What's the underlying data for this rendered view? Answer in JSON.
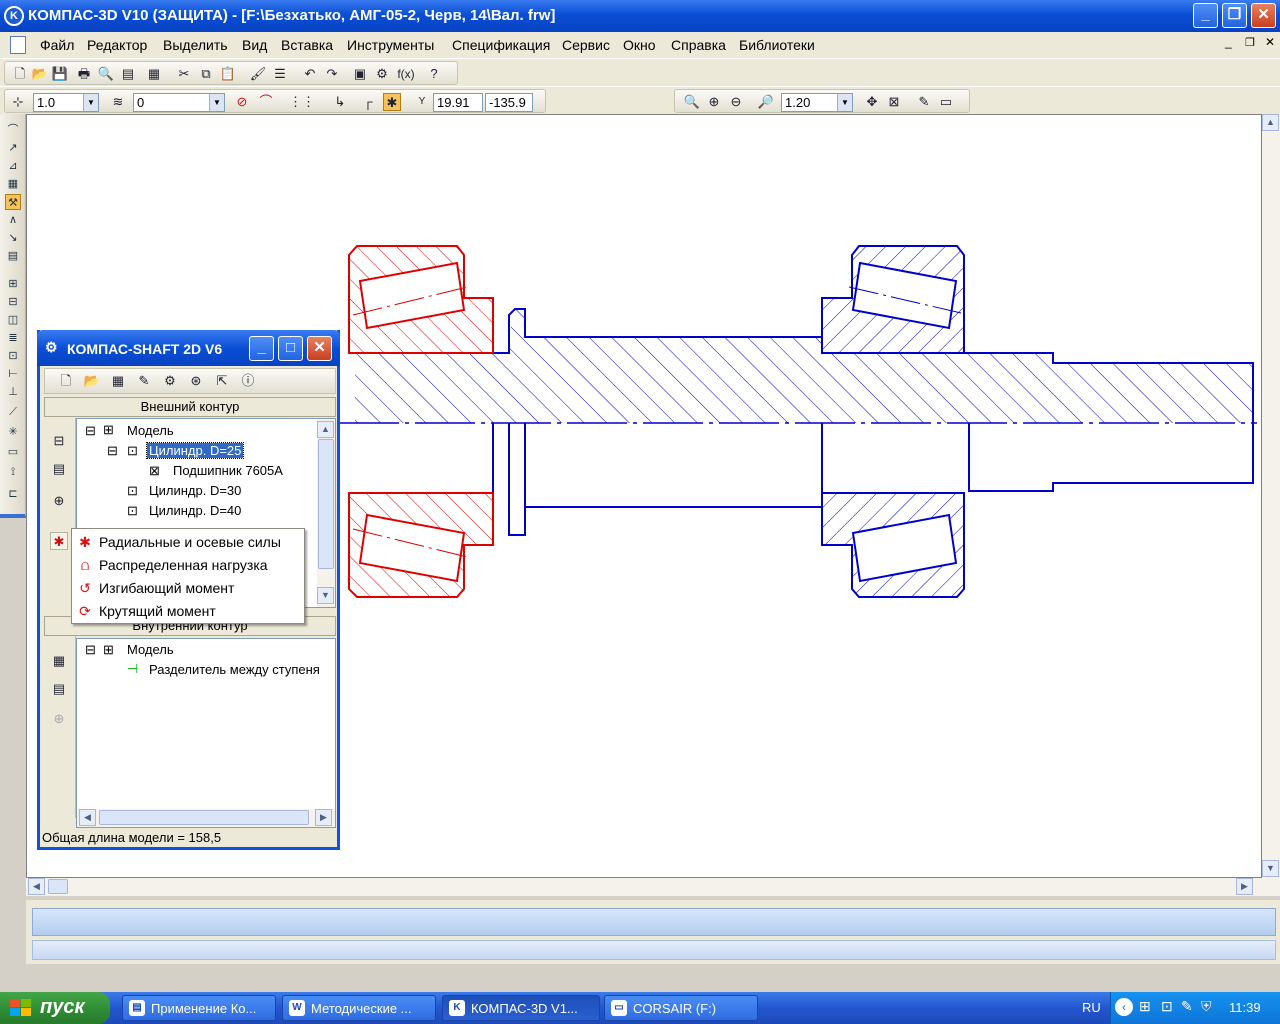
{
  "window": {
    "title": "КОМПАС-3D V10 (ЗАЩИТА) - [F:\\Безхатько, АМГ-05-2, Черв, 14\\Вал. frw]",
    "app_icon_glyph": "K",
    "min_glyph": "_",
    "max_glyph": "❐",
    "close_glyph": "✕"
  },
  "menu": {
    "items": [
      "Файл",
      "Редактор",
      "Выделить",
      "Вид",
      "Вставка",
      "Инструменты",
      "Спецификация",
      "Сервис",
      "Окно",
      "Справка",
      "Библиотеки"
    ]
  },
  "toolbar2": {
    "step_value": "1.0",
    "layer_value": "0",
    "coord_x": "19.91",
    "coord_y": "-135.9",
    "zoom_value": "1.20",
    "fx_label": "f(x)"
  },
  "shaft_window": {
    "title": "КОМПАС-SHAFT 2D V6",
    "outer_contour_label": "Внешний контур",
    "inner_contour_label": "Внутренний контур",
    "outer_tree": {
      "root": "Модель",
      "items": [
        "Цилиндр. D=25",
        "Подшипник 7605A",
        "Цилиндр. D=30",
        "Цилиндр. D=40"
      ]
    },
    "inner_tree": {
      "root": "Модель",
      "items": [
        "Разделитель между ступеня"
      ]
    },
    "status": "Общая длина модели = 158,5"
  },
  "context_menu": {
    "items": [
      "Радиальные и осевые силы",
      "Распределенная нагрузка",
      "Изгибающий момент",
      "Крутящий момент"
    ]
  },
  "taskbar": {
    "start_label": "пуск",
    "tasks": [
      "Применение Ко...",
      "Методические ...",
      "КОМПАС-3D V1...",
      "CORSAIR (F:)"
    ],
    "lang": "RU",
    "clock": "11:39"
  },
  "colors": {
    "red_bearing": "#e00000",
    "blue_shaft": "#0000cc",
    "title_blue": "#0a4fd6"
  }
}
